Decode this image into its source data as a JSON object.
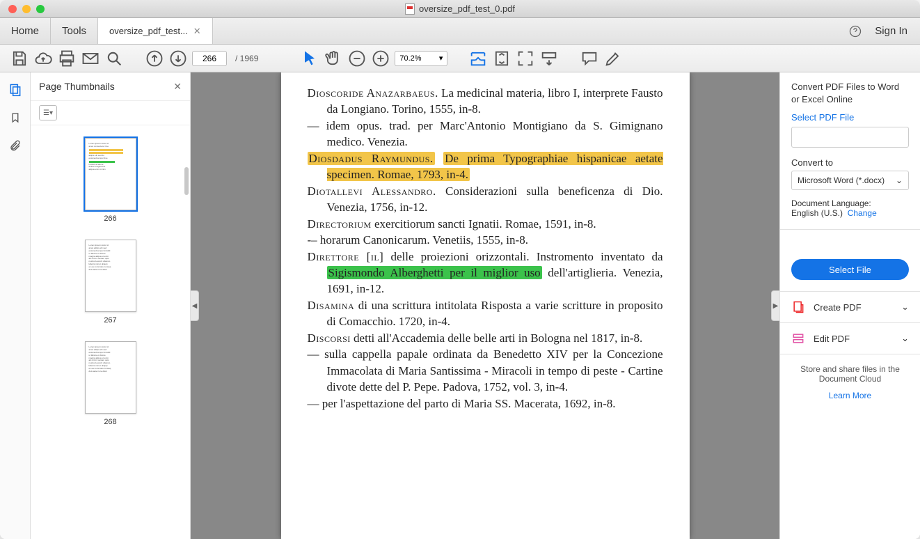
{
  "window": {
    "title": "oversize_pdf_test_0.pdf"
  },
  "tabs": {
    "home": "Home",
    "tools": "Tools",
    "doc": "oversize_pdf_test..."
  },
  "header_right": {
    "signin": "Sign In"
  },
  "toolbar": {
    "page_current": "266",
    "page_total": "/ 1969",
    "zoom": "70.2%"
  },
  "thumbs": {
    "title": "Page Thumbnails",
    "items": [
      {
        "num": "266",
        "selected": true
      },
      {
        "num": "267",
        "selected": false
      },
      {
        "num": "268",
        "selected": false
      }
    ]
  },
  "doc": {
    "lines": [
      {
        "caps": "Dioscoride Anazarbaeus.",
        "rest": " La medicinal materia, libro I, interprete Fausto da Longiano. Torino, 1555, in-8."
      },
      {
        "dash": true,
        "rest": "idem opus. trad. per Marc'Antonio Montigiano da S. Gimignano medico. Venezia."
      },
      {
        "hl": "y",
        "caps": "Diosdadus Raymundus.",
        "rest": " De prima Typographiae hispanicae aetate specimen. Romae, 1793, in-4."
      },
      {
        "caps": "Diotallevi Alessandro.",
        "rest": " Considerazioni sulla beneficenza di Dio. Venezia, 1756, in-12."
      },
      {
        "caps": "Directorium",
        "rest": " exercitiorum sancti Ignatii. Romae, 1591, in-8."
      },
      {
        "dash": true,
        "rest": "horarum Canonicarum. Venetiis, 1555, in-8."
      },
      {
        "caps": "Direttore [il]",
        "rest_a": " delle proiezioni orizzontali. Instromento inventato da ",
        "hl_part": "Sigismondo Alberghetti per il miglior uso",
        "rest_b": " dell'artiglieria. Venezia, 1691, in-12."
      },
      {
        "caps": "Disamina",
        "rest": " di una scrittura intitolata Risposta a varie scritture in proposito di Comacchio. 1720, in-4."
      },
      {
        "caps": "Discorsi",
        "rest": " detti all'Accademia delle belle arti in Bologna nel 1817, in-8."
      },
      {
        "dash": true,
        "rest": "sulla cappella papale ordinata da Benedetto XIV per la Concezione Immacolata di Maria Santissima - Miracoli in tempo di peste - Cartine divote dette del P. Pepe. Padova, 1752, vol. 3, in-4."
      },
      {
        "dash": true,
        "rest": "per l'aspettazione del parto di Maria SS. Macerata, 1692, in-8."
      }
    ]
  },
  "rpanel": {
    "convert_head": "Convert PDF Files to Word or Excel Online",
    "select_pdf": "Select PDF File",
    "convert_to": "Convert to",
    "convert_option": "Microsoft Word (*.docx)",
    "lang_label": "Document Language:",
    "lang_value": "English (U.S.)",
    "change": "Change",
    "select_file_btn": "Select File",
    "create_pdf": "Create PDF",
    "edit_pdf": "Edit PDF",
    "store_share": "Store and share files in the Document Cloud",
    "learn_more": "Learn More"
  }
}
